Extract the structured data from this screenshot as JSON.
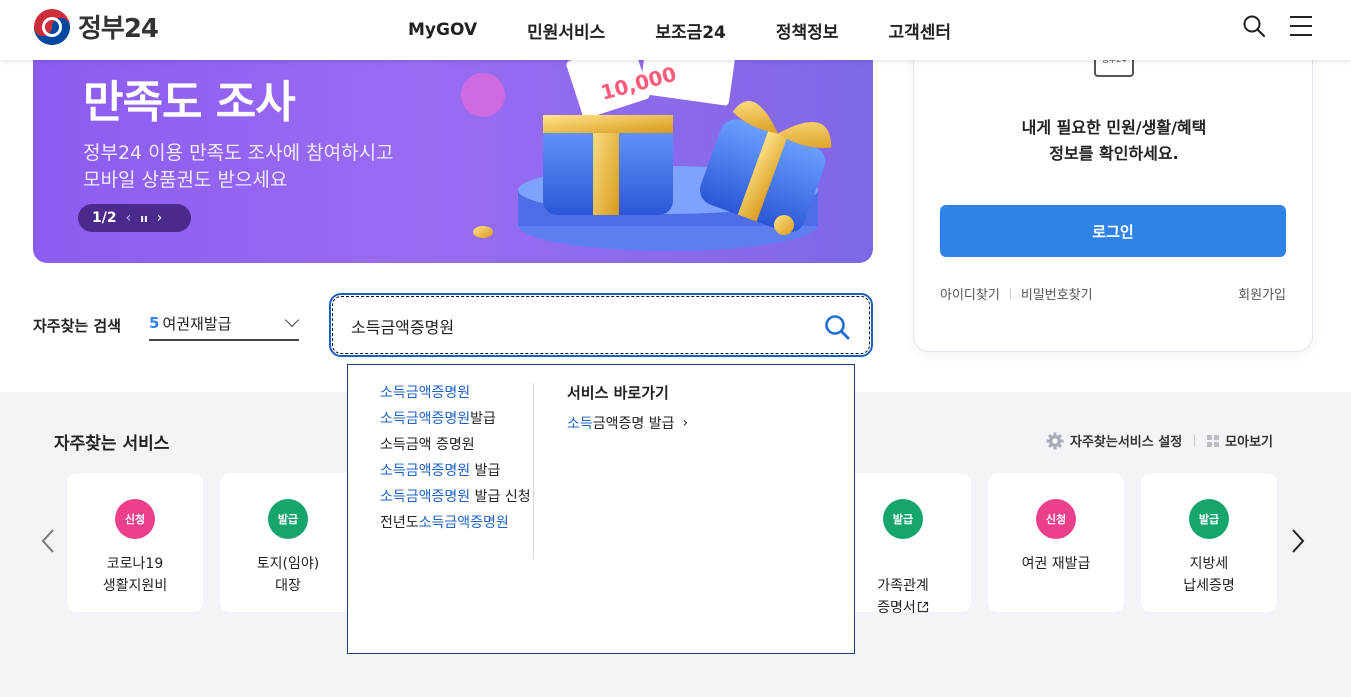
{
  "header": {
    "logo_text": "정부24",
    "nav": [
      "MyGOV",
      "민원서비스",
      "보조금24",
      "정책정보",
      "고객센터"
    ]
  },
  "banner": {
    "title": "만족도 조사",
    "desc_line1": "정부24 이용 만족도 조사에 참여하시고",
    "desc_line2": "모바일 상품권도 받으세요",
    "pager": "1/2",
    "prev_glyph": "‹",
    "pause_glyph": "ıı",
    "next_glyph": "›"
  },
  "login": {
    "badge_text": "정부24",
    "message": "내게 필요한 민원/생활/혜택\n정보를 확인하세요.",
    "button": "로그인",
    "find_id": "아이디찾기",
    "find_pw": "비밀번호찾기",
    "signup": "회원가입"
  },
  "search": {
    "fav_label": "자주찾는 검색",
    "fav_num": "5",
    "fav_value": "여권재발급",
    "query": "소득금액증명원"
  },
  "autocomplete": {
    "suggestions": [
      {
        "hl": "소득금액증명원",
        "rest": ""
      },
      {
        "hl": "소득금액증명원",
        "rest": "발급"
      },
      {
        "hl": "",
        "rest": "소득금액 증명원"
      },
      {
        "hl": "소득금액증명원",
        "rest": " 발급"
      },
      {
        "hl": "소득금액증명원",
        "rest": " 발급 신청"
      },
      {
        "pre": "전년도",
        "hl": "소득금액증명원",
        "rest": ""
      }
    ],
    "shortcut_title": "서비스 바로가기",
    "shortcut_hl": "소득",
    "shortcut_rest": "금액증명 발급",
    "shortcut_arrow": "›"
  },
  "services": {
    "title": "자주찾는 서비스",
    "settings": "자주찾는서비스 설정",
    "view_all": "모아보기",
    "cards": [
      {
        "badge": "신청",
        "type": "apply",
        "label": "코로나19\n생활지원비"
      },
      {
        "badge": "발급",
        "type": "issue",
        "label": "토지(임야)\n대장"
      },
      {
        "badge": "발급",
        "type": "issue",
        "label": "가족관계\n증명서"
      },
      {
        "badge": "신청",
        "type": "apply",
        "label": "여권 재발급"
      },
      {
        "badge": "발급",
        "type": "issue",
        "label": "지방세\n납세증명"
      }
    ]
  }
}
